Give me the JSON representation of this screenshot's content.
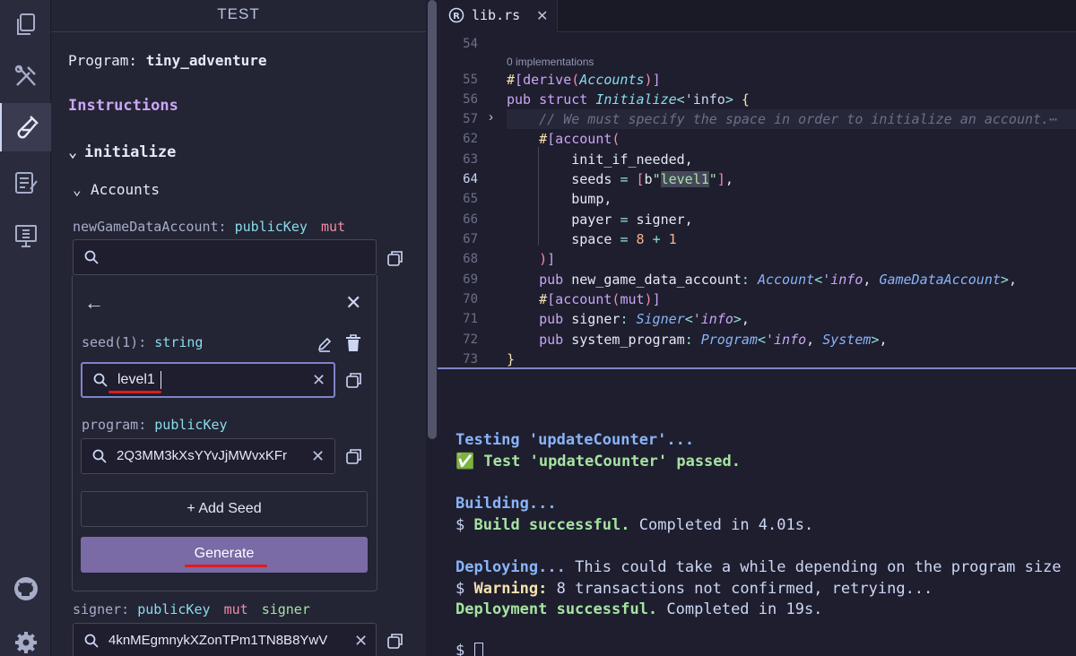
{
  "sidebar": {
    "title": "TEST",
    "program_label": "Program:",
    "program_name": "tiny_adventure",
    "instructions_heading": "Instructions",
    "instruction_name": "initialize",
    "accounts_label": "Accounts",
    "account1": {
      "name": "newGameDataAccount:",
      "type": "publicKey",
      "flag": "mut",
      "search_value": ""
    },
    "seed_panel": {
      "seed1_label": "seed(1):",
      "seed1_type": "string",
      "seed1_value": "level1",
      "program_label": "program:",
      "program_type": "publicKey",
      "program_value": "2Q3MM3kXsYYvJjMWvxKFr",
      "add_seed_label": "+ Add Seed",
      "generate_label": "Generate"
    },
    "signer": {
      "name": "signer:",
      "type": "publicKey",
      "flag1": "mut",
      "flag2": "signer",
      "value": "4knMEgmnykXZonTPm1TN8B8YwV"
    }
  },
  "editor": {
    "tab_label": "lib.rs",
    "codelens": "0 implementations",
    "line_numbers": [
      "54",
      "55",
      "56",
      "57",
      "62",
      "63",
      "64",
      "65",
      "66",
      "67",
      "68",
      "69",
      "70",
      "71",
      "72",
      "73"
    ],
    "current_line": "64"
  },
  "terminal": {
    "l1": "Testing 'updateCounter'...",
    "l2_check": "✅",
    "l2": "Test 'updateCounter' passed.",
    "l3": "Building...",
    "l4_prompt": "$",
    "l4_bold": "Build successful.",
    "l4_rest": "Completed in 4.01s.",
    "l5_bold": "Deploying...",
    "l5_rest": "This could take a while depending on the program size",
    "l6_prompt": "$",
    "l6_bold": "Warning:",
    "l6_rest": "8 transactions not confirmed, retrying...",
    "l7_bold": "Deployment successful.",
    "l7_rest": "Completed in 19s.",
    "l8_prompt": "$"
  }
}
